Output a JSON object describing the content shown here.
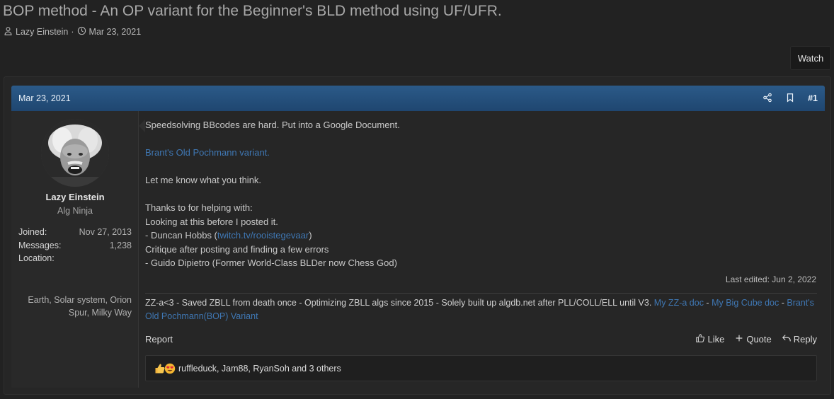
{
  "thread": {
    "title": "BOP method - An OP variant for the Beginner's BLD method using UF/UFR.",
    "author": "Lazy Einstein",
    "separator": "·",
    "date": "Mar 23, 2021"
  },
  "watch_label": "Watch",
  "post": {
    "date": "Mar 23, 2021",
    "number": "#1",
    "user": {
      "name": "Lazy Einstein",
      "title": "Alg Ninja",
      "joined_label": "Joined:",
      "joined_value": "Nov 27, 2013",
      "messages_label": "Messages:",
      "messages_value": "1,238",
      "location_label": "Location:",
      "location_value": "Earth, Solar system, Orion Spur, Milky Way"
    },
    "body": {
      "line1": "Speedsolving BBcodes are hard. Put into a Google Document.",
      "link1": "Brant's Old Pochmann variant.",
      "line2": "Let me know what you think.",
      "line3": "Thanks to for helping with:",
      "line4": "Looking at this before I posted it.",
      "line5_pre": "- Duncan Hobbs (",
      "line5_link": "twitch.tv/rooistegevaar",
      "line5_post": ")",
      "line6": "Critique after posting and finding a few errors",
      "line7": "- Guido Dipietro (Former World-Class BLDer now Chess God)"
    },
    "last_edited": "Last edited: Jun 2, 2022",
    "signature": {
      "text": "ZZ-a<3 - Saved ZBLL from death once - Optimizing ZBLL algs since 2015 - Solely built up algdb.net after PLL/COLL/ELL until V3. ",
      "link1": "My ZZ-a doc",
      "sep1": " - ",
      "link2": "My Big Cube doc",
      "sep2": " - ",
      "link3": "Brant's Old Pochmann(BOP) Variant"
    },
    "actions": {
      "report": "Report",
      "like": "Like",
      "quote": "Quote",
      "reply": "Reply"
    },
    "reactions": {
      "text": "ruffleduck, Jam88, RyanSoh and 3 others"
    }
  }
}
